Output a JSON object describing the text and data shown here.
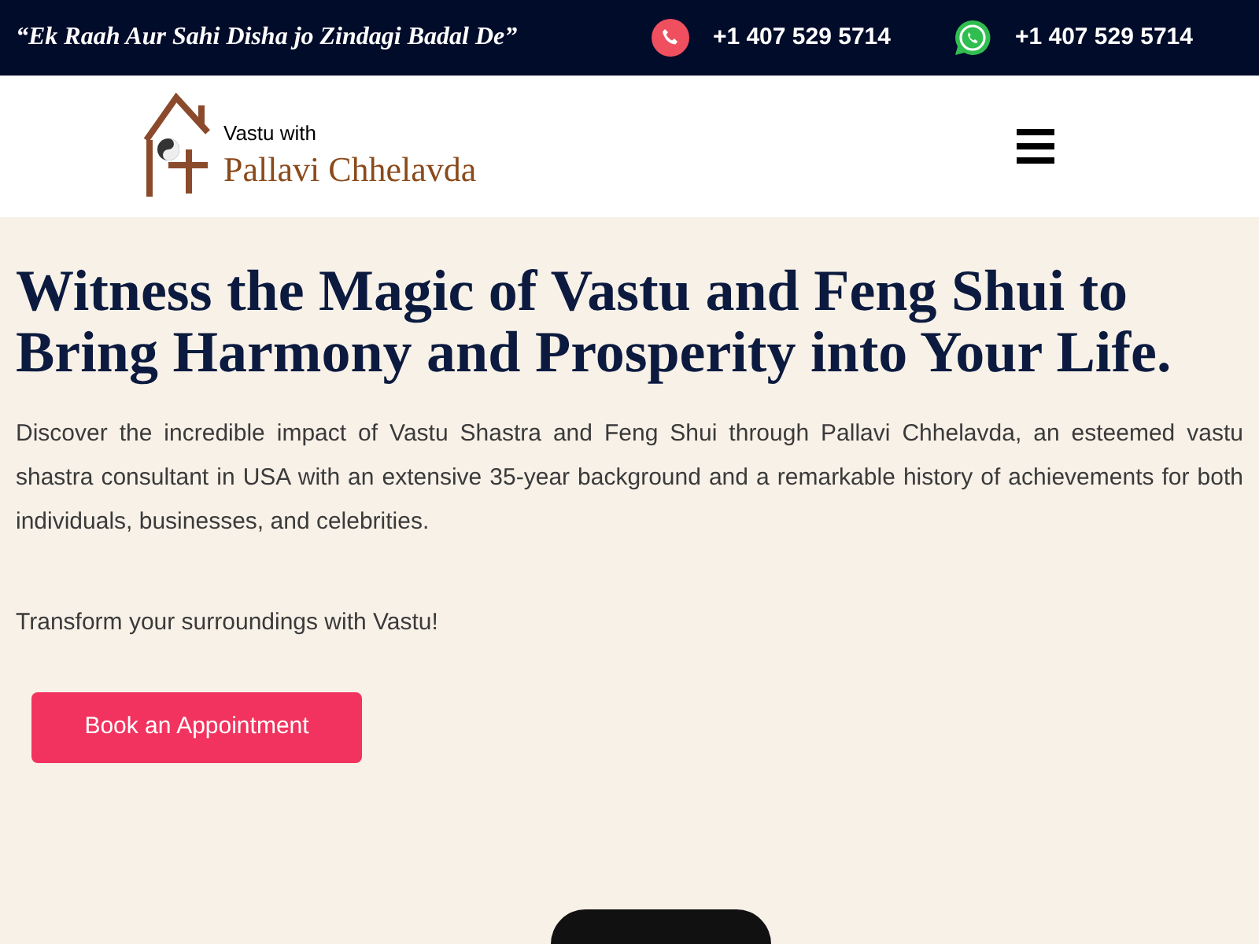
{
  "top_bar": {
    "tagline": "“Ek Raah Aur Sahi Disha jo Zindagi Badal De”",
    "contacts": [
      {
        "kind": "phone",
        "number": "+1 407 529 5714"
      },
      {
        "kind": "whatsapp",
        "number": "+1 407 529 5714"
      }
    ]
  },
  "header": {
    "logo": {
      "line_1": "Vastu with",
      "line_2": "Pallavi Chhelavda"
    }
  },
  "hero": {
    "heading": "Witness the Magic of Vastu and Feng Shui to Bring Harmony and Prosperity into Your Life.",
    "paragraphs": [
      "Discover the incredible impact of Vastu Shastra and Feng Shui through Pallavi Chhelavda, an esteemed vastu shastra consultant in USA with an extensive 35-year background and a remarkable history of achievements for both individuals, businesses, and celebrities.",
      "Transform your surroundings with Vastu!"
    ],
    "button": "Book an Appointment"
  }
}
